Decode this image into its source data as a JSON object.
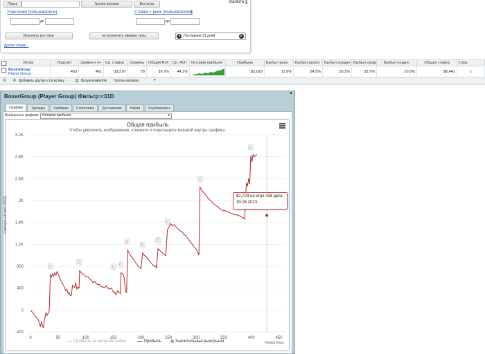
{
  "filters": {
    "search_btn": "Поиск",
    "group_select": "Группа игроков",
    "games_select": "Все игры",
    "currency_label": "Валюта",
    "currency_value": "$",
    "participants_link": "Участники (пользователи)",
    "stake_link": "Ставка + рейк (пользователи)",
    "stake_currency": "$",
    "to_label_1": "до",
    "to_label_2": "до",
    "include_types_btn": "Включить все типы",
    "exclude_types_btn": "не исключать никакие типы",
    "period_value": "Последние 31 дней",
    "other_options_link": "Другие опции..."
  },
  "table": {
    "headers": [
      "Игрок",
      "Подсчет",
      "Заявки и уч",
      "Ср. ставка",
      "Уровень",
      "Общий ROI",
      "Ср. ROI",
      "История прибыли",
      "Прибыль",
      "Выбыл рано",
      "Выбыл рано/с",
      "Выбыл средне",
      "Выбыл средн",
      "Выбыл поздно",
      "Общая ставка",
      "Стра"
    ],
    "row": {
      "player_name": "BoxerGroup",
      "player_sub": "Player Group",
      "count": "453",
      "entries": "461",
      "avg_stake": "$13.97",
      "level": "78",
      "total_roi": "39.7%",
      "avg_roi": "44.1%",
      "profit": "$2,819",
      "early": "11.9%",
      "early_mid": "24.5%",
      "mid": "20.1%",
      "mid2": "32.7%",
      "late": "10.8%",
      "total_stake": "$6,441",
      "close": "x"
    },
    "footer_add": "Добавить другую статистику",
    "footer_visualize": "Визуализируйте",
    "footer_groups": "Группы игроков"
  },
  "dialog": {
    "title": "BoxerGroup (Player Group) Фильтр:<31D",
    "close": "×",
    "tabs": [
      "Графики",
      "Турниры",
      "Разбивка",
      "Статистика",
      "Достижения",
      "Найти",
      "Опубликовать"
    ],
    "selected_chart_label": "Выбранные графики:",
    "selected_chart_value": "История прибыли"
  },
  "chart_data": {
    "type": "line",
    "title": "Общая прибыль",
    "subtitle": "Чтобы увеличить изображение, кликните и перетащите мышкой внутрь графика.",
    "ylabel": "Совокупный итог (USD)",
    "xlabel": "Номер игры",
    "xlim": [
      0,
      453
    ],
    "ylim": [
      -400,
      3200
    ],
    "x_ticks": [
      "0",
      "50",
      "100",
      "150",
      "200",
      "250",
      "300",
      "350",
      "400",
      "450"
    ],
    "y_ticks": [
      "-400",
      "0",
      "400",
      "800",
      "1.2K",
      "1.6K",
      "2K",
      "2.4K",
      "2.8K",
      "3.2K"
    ],
    "legend": [
      "Прибыль за минусом рейка",
      "Прибыль",
      "Значительные выигрыши"
    ],
    "series": [
      {
        "name": "Прибыль",
        "color": "#b5242a",
        "points": [
          [
            0,
            0
          ],
          [
            5,
            -60
          ],
          [
            10,
            -130
          ],
          [
            15,
            -200
          ],
          [
            18,
            -300
          ],
          [
            20,
            -220
          ],
          [
            23,
            -330
          ],
          [
            25,
            -200
          ],
          [
            28,
            -50
          ],
          [
            30,
            -100
          ],
          [
            32,
            -60
          ],
          [
            34,
            -10
          ],
          [
            36,
            650
          ],
          [
            38,
            600
          ],
          [
            40,
            660
          ],
          [
            42,
            620
          ],
          [
            44,
            680
          ],
          [
            46,
            640
          ],
          [
            48,
            700
          ],
          [
            50,
            660
          ],
          [
            52,
            620
          ],
          [
            54,
            560
          ],
          [
            56,
            520
          ],
          [
            58,
            480
          ],
          [
            60,
            450
          ],
          [
            62,
            400
          ],
          [
            64,
            350
          ],
          [
            66,
            380
          ],
          [
            68,
            300
          ],
          [
            70,
            320
          ],
          [
            72,
            260
          ],
          [
            74,
            270
          ],
          [
            76,
            450
          ],
          [
            78,
            430
          ],
          [
            80,
            410
          ],
          [
            82,
            500
          ],
          [
            84,
            380
          ],
          [
            86,
            420
          ],
          [
            88,
            400
          ],
          [
            89,
            720
          ],
          [
            92,
            680
          ],
          [
            95,
            650
          ],
          [
            98,
            640
          ],
          [
            101,
            600
          ],
          [
            104,
            610
          ],
          [
            107,
            570
          ],
          [
            110,
            550
          ],
          [
            113,
            500
          ],
          [
            116,
            520
          ],
          [
            119,
            490
          ],
          [
            122,
            460
          ],
          [
            125,
            470
          ],
          [
            128,
            430
          ],
          [
            131,
            420
          ],
          [
            134,
            410
          ],
          [
            137,
            440
          ],
          [
            140,
            400
          ],
          [
            143,
            380
          ],
          [
            146,
            400
          ],
          [
            149,
            360
          ],
          [
            150,
            320
          ],
          [
            152,
            330
          ],
          [
            155,
            280
          ],
          [
            158,
            350
          ],
          [
            160,
            320
          ],
          [
            163,
            300
          ],
          [
            164,
            680
          ],
          [
            167,
            660
          ],
          [
            170,
            580
          ],
          [
            172,
            330
          ],
          [
            174,
            320
          ],
          [
            176,
            1100
          ],
          [
            178,
            1050
          ],
          [
            181,
            1000
          ],
          [
            184,
            960
          ],
          [
            187,
            920
          ],
          [
            190,
            870
          ],
          [
            193,
            830
          ],
          [
            196,
            790
          ],
          [
            199,
            780
          ],
          [
            200,
            750
          ],
          [
            203,
            1040
          ],
          [
            206,
            1000
          ],
          [
            209,
            980
          ],
          [
            212,
            940
          ],
          [
            215,
            900
          ],
          [
            218,
            860
          ],
          [
            221,
            830
          ],
          [
            224,
            800
          ],
          [
            227,
            800
          ],
          [
            228,
            760
          ],
          [
            231,
            1120
          ],
          [
            234,
            1090
          ],
          [
            237,
            1060
          ],
          [
            240,
            1030
          ],
          [
            243,
            1010
          ],
          [
            245,
            990
          ],
          [
            248,
            1460
          ],
          [
            251,
            1520
          ],
          [
            254,
            1580
          ],
          [
            257,
            1540
          ],
          [
            260,
            1560
          ],
          [
            263,
            1520
          ],
          [
            266,
            1500
          ],
          [
            269,
            1460
          ],
          [
            272,
            1440
          ],
          [
            275,
            1420
          ],
          [
            278,
            1380
          ],
          [
            281,
            1360
          ],
          [
            284,
            1320
          ],
          [
            287,
            1280
          ],
          [
            290,
            1240
          ],
          [
            293,
            1200
          ],
          [
            296,
            1160
          ],
          [
            299,
            1120
          ],
          [
            302,
            1080
          ],
          [
            305,
            1000
          ],
          [
            307,
            2240
          ],
          [
            310,
            2200
          ],
          [
            313,
            2150
          ],
          [
            316,
            2120
          ],
          [
            319,
            2080
          ],
          [
            322,
            2040
          ],
          [
            325,
            2010
          ],
          [
            328,
            1980
          ],
          [
            331,
            1950
          ],
          [
            334,
            1920
          ],
          [
            337,
            1900
          ],
          [
            340,
            1880
          ],
          [
            343,
            1850
          ],
          [
            346,
            1830
          ],
          [
            349,
            1810
          ],
          [
            352,
            1820
          ],
          [
            355,
            1800
          ],
          [
            358,
            1790
          ],
          [
            361,
            1780
          ],
          [
            364,
            1760
          ],
          [
            367,
            1760
          ],
          [
            370,
            1740
          ],
          [
            373,
            1740
          ],
          [
            376,
            1730
          ],
          [
            379,
            1720
          ],
          [
            382,
            1700
          ],
          [
            385,
            1690
          ],
          [
            388,
            1660
          ],
          [
            391,
            2320
          ],
          [
            393,
            2260
          ],
          [
            395,
            2400
          ],
          [
            397,
            2300
          ],
          [
            399,
            2820
          ],
          [
            401,
            2700
          ],
          [
            403,
            2840
          ],
          [
            405,
            2800
          ],
          [
            407,
            2820
          ],
          [
            410,
            2840
          ]
        ]
      }
    ],
    "annotations": [
      "C",
      "C",
      "C",
      "C",
      "C",
      "C",
      "C",
      "C",
      "C",
      "C"
    ],
    "tooltip_line1": "$1,729 на игре 428 дата",
    "tooltip_line2": "30.08.2023"
  }
}
